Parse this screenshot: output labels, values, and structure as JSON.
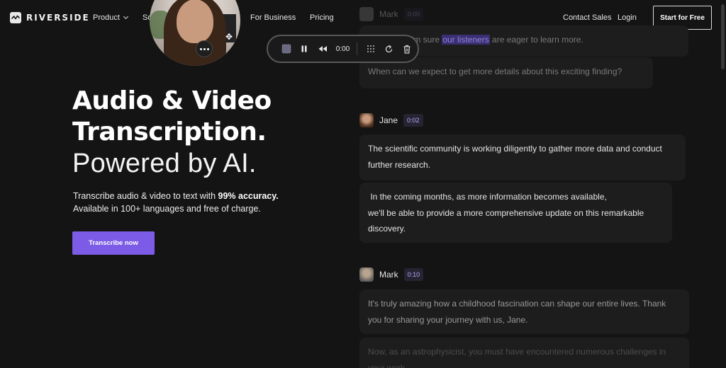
{
  "nav": {
    "brand": "RIVERSIDE",
    "product": "Product",
    "solutions": "Sol",
    "business": "For Business",
    "pricing": "Pricing",
    "contact": "Contact Sales",
    "login": "Login",
    "start": "Start for Free"
  },
  "hero": {
    "title_line1": "Audio & Video",
    "title_line2": "Transcription.",
    "title_line3": "Powered by AI.",
    "subtitle_pre": "Transcribe audio & video to text with ",
    "subtitle_bold": "99% accuracy.",
    "subtitle_line2": "Available in 100+ languages and free of charge.",
    "cta": "Transcribe now"
  },
  "player": {
    "time": "0:00"
  },
  "transcript": {
    "first_block": {
      "speaker": "Mark",
      "time": "0:00",
      "line1_pre": "Incredible! I'm sure ",
      "line1_highlight": "our listeners",
      "line1_post": " are eager to learn more.",
      "line2": "When can we expect to get more details about this exciting finding?"
    },
    "second_block": {
      "speaker": "Jane",
      "time": "0:02",
      "para1": "The scientific community is working diligently to gather more data and conduct further research.",
      "para2_line1": " In the coming months, as more information becomes available,",
      "para2_line2": "we'll be able to provide a more comprehensive update on this remarkable discovery."
    },
    "third_block": {
      "speaker": "Mark",
      "time": "0:10",
      "para1": "It's truly amazing how a childhood fascination can shape our entire lives. Thank you for sharing your journey with us, Jane.",
      "para2": "Now, as an astrophysicist, you must have encountered numerous challenges in your work."
    }
  },
  "colors": {
    "background": "#141414",
    "accent": "#7c5ce6",
    "highlight": "#3b2f73"
  }
}
